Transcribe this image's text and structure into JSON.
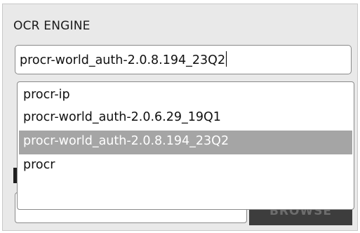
{
  "ocr_engine": {
    "label": "OCR ENGINE",
    "value": "procr-world_auth-2.0.8.194_23Q2",
    "options": [
      "procr-ip",
      "procr-world_auth-2.0.6.29_19Q1",
      "procr-world_auth-2.0.8.194_23Q2",
      "procr"
    ],
    "selected_option": "procr-world_auth-2.0.8.194_23Q2",
    "dropdown_open": true
  },
  "browse": {
    "label": "BROWSE"
  },
  "colors": {
    "panel_bg": "#e9e9e9",
    "selected_bg": "#a5a5a5",
    "button_bg": "#3d3d3d"
  }
}
